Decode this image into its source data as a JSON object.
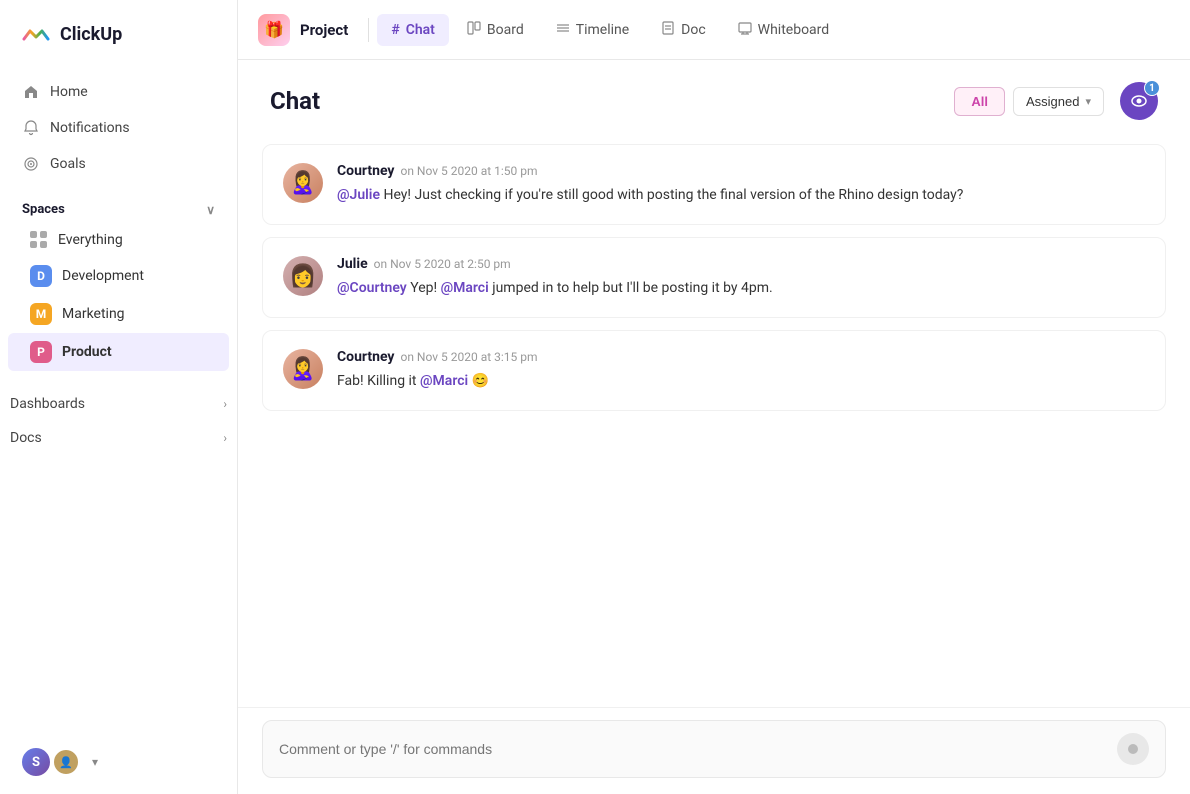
{
  "app": {
    "name": "ClickUp"
  },
  "sidebar": {
    "nav": [
      {
        "id": "home",
        "label": "Home",
        "icon": "🏠"
      },
      {
        "id": "notifications",
        "label": "Notifications",
        "icon": "🔔"
      },
      {
        "id": "goals",
        "label": "Goals",
        "icon": "🏆"
      }
    ],
    "spaces_label": "Spaces",
    "spaces": [
      {
        "id": "everything",
        "label": "Everything",
        "type": "everything"
      },
      {
        "id": "development",
        "label": "Development",
        "type": "badge",
        "badge_letter": "D",
        "badge_color": "#5a8dee"
      },
      {
        "id": "marketing",
        "label": "Marketing",
        "type": "badge",
        "badge_letter": "M",
        "badge_color": "#f5a623"
      },
      {
        "id": "product",
        "label": "Product",
        "type": "badge",
        "badge_letter": "P",
        "badge_color": "#e05c8a",
        "active": true
      }
    ],
    "sections": [
      {
        "id": "dashboards",
        "label": "Dashboards"
      },
      {
        "id": "docs",
        "label": "Docs"
      }
    ],
    "user": {
      "initials": "S",
      "chevron": "▾"
    }
  },
  "topbar": {
    "project_icon": "🎁",
    "project_title": "Project",
    "tabs": [
      {
        "id": "chat",
        "label": "Chat",
        "icon": "#",
        "active": true
      },
      {
        "id": "board",
        "label": "Board",
        "icon": "□"
      },
      {
        "id": "timeline",
        "label": "Timeline",
        "icon": "≡"
      },
      {
        "id": "doc",
        "label": "Doc",
        "icon": "📄"
      },
      {
        "id": "whiteboard",
        "label": "Whiteboard",
        "icon": "✏️"
      }
    ]
  },
  "chat": {
    "title": "Chat",
    "filter_all": "All",
    "filter_assigned": "Assigned",
    "eye_badge": "1",
    "messages": [
      {
        "id": "msg1",
        "author": "Courtney",
        "time": "on Nov 5 2020 at 1:50 pm",
        "avatar_emoji": "👩",
        "text_pre": "",
        "mention1": "@Julie",
        "text_mid": " Hey! Just checking if you're still good with posting the final version of the Rhino design today?",
        "mention2": "",
        "text_end": ""
      },
      {
        "id": "msg2",
        "author": "Julie",
        "time": "on Nov 5 2020 at 2:50 pm",
        "avatar_emoji": "👩",
        "mention1": "@Courtney",
        "text_mid": " Yep! ",
        "mention2": "@Marci",
        "text_end": " jumped in to help but I'll be posting it by 4pm."
      },
      {
        "id": "msg3",
        "author": "Courtney",
        "time": "on Nov 5 2020 at 3:15 pm",
        "avatar_emoji": "👩",
        "text_pre": "Fab! Killing it ",
        "mention1": "@Marci",
        "text_end": " 😊"
      }
    ],
    "input_placeholder": "Comment or type '/' for commands"
  }
}
